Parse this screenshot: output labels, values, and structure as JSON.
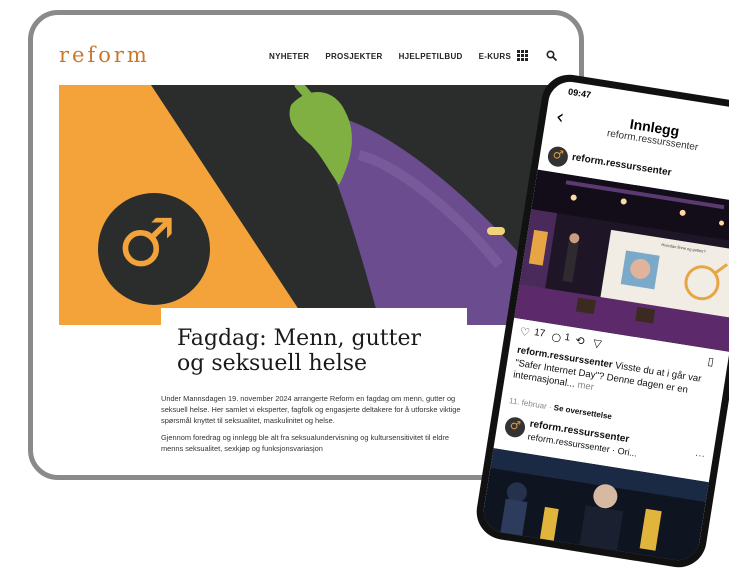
{
  "tablet": {
    "site": {
      "logo": "reform",
      "nav": [
        "NYHETER",
        "PROSJEKTER",
        "HJELPETILBUD",
        "E-KURS"
      ],
      "icons": [
        "grid-icon",
        "search-icon"
      ]
    },
    "hero": {
      "symbol": "♂",
      "colors": {
        "orange": "#f3a33a",
        "dark": "#2a2d2c",
        "purple": "#6b4d8f",
        "green": "#7fb041"
      }
    },
    "article": {
      "title": "Fagdag: Menn, gutter og seksuell helse",
      "paragraphs": [
        "Under Mannsdagen 19. november 2024 arrangerte Reform en fagdag om menn, gutter og seksuell helse. Her samlet vi eksperter, fagfolk og engasjerte deltakere for å utforske viktige spørsmål knyttet til seksualitet, maskulinitet og helse.",
        "Gjennom foredrag og innlegg ble alt fra seksualundervisning og kultursensitivitet til eldre menns seksualitet, sexkjøp og funksjonsvariasjon"
      ]
    }
  },
  "phone": {
    "status": {
      "time": "09:47",
      "icons": "▴ ◉ ▮"
    },
    "header": {
      "title": "Innlegg",
      "subtitle": "reform.ressurssenter"
    },
    "post": {
      "author": "reform.ressurssenter",
      "likes": "17",
      "comments": "1",
      "caption_author": "reform.ressurssenter",
      "caption_text": " Visste du at i går var \"Safer Internet Day\"? Denne dagen er en internasjonal...",
      "caption_more": " mer",
      "date": "11. februar",
      "translate": "Se oversettelse",
      "slide_text": "Hvordan finne og guttes?"
    },
    "next_post": {
      "author": "reform.ressurssenter",
      "subtitle": "reform.ressurssenter · Ori..."
    }
  }
}
